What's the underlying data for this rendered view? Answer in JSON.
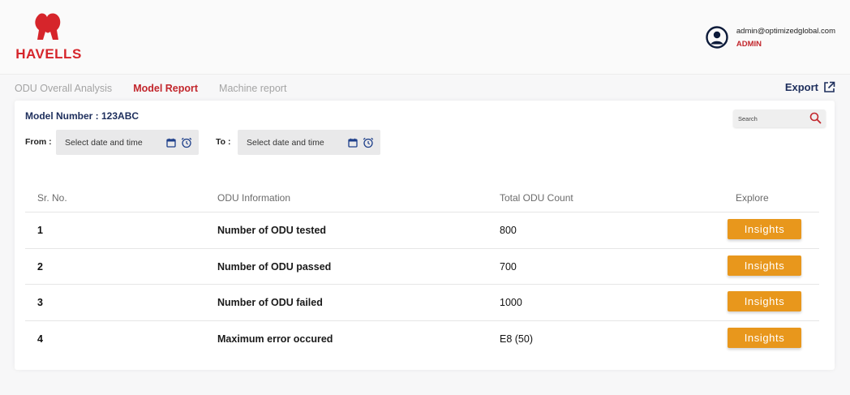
{
  "brand": {
    "name": "HAVELLS",
    "color": "#d6252b"
  },
  "user": {
    "email": "admin@optimizedglobal.com",
    "role": "ADMIN",
    "icon": "user-circle-icon"
  },
  "tabs": [
    {
      "label": "ODU Overall Analysis",
      "active": false
    },
    {
      "label": "Model Report",
      "active": true
    },
    {
      "label": "Machine report",
      "active": false
    }
  ],
  "export": {
    "label": "Export",
    "icon": "external-link-icon"
  },
  "model": {
    "label": "Model Number : 123ABC"
  },
  "search": {
    "placeholder": "Search",
    "icon": "search-icon"
  },
  "dates": {
    "from_label": "From :",
    "to_label": "To :",
    "from_placeholder": "Select date and time",
    "to_placeholder": "Select date and time"
  },
  "table": {
    "columns": [
      "Sr. No.",
      "ODU Information",
      "Total ODU Count",
      "Explore"
    ],
    "rows": [
      {
        "sr": "1",
        "info": "Number of ODU tested",
        "count": "800",
        "action": "Insights"
      },
      {
        "sr": "2",
        "info": "Number of ODU passed",
        "count": "700",
        "action": "Insights"
      },
      {
        "sr": "3",
        "info": "Number of ODU failed",
        "count": "1000",
        "action": "Insights"
      },
      {
        "sr": "4",
        "info": "Maximum error occured",
        "count": "E8 (50)",
        "action": "Insights"
      }
    ]
  },
  "colors": {
    "accent": "#c2262c",
    "button": "#e8971c",
    "navy": "#1d2e5c"
  }
}
